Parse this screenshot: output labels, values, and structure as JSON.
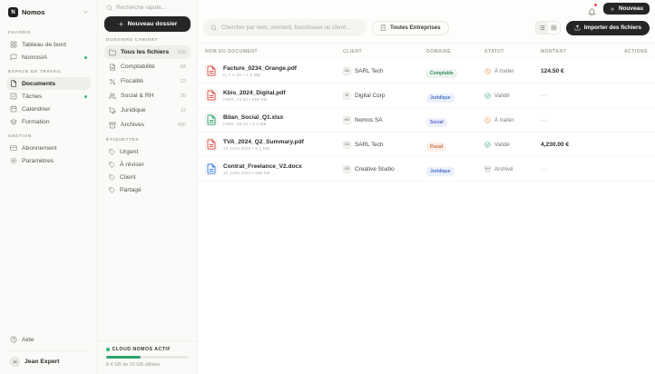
{
  "colors": {
    "accent_dark": "#262624",
    "green": "#2FA36B",
    "notification_red": "#E5484D",
    "status_pending": "#E8883C",
    "status_valid": "#3BA26B",
    "status_archived": "#9A9A94",
    "badge_green_text": "#3D8B5F",
    "badge_blue_text": "#4A73C9",
    "badge_indigo_text": "#5B68CE",
    "badge_orange_text": "#D4663B"
  },
  "sidebar": {
    "logo_letter": "N",
    "logo_name": "Nomos",
    "sections": [
      {
        "label": "Favoris",
        "items": [
          {
            "label": "Tableau de bord",
            "icon": "grid",
            "active": false,
            "dot": false
          },
          {
            "label": "NomosIA",
            "icon": "chat",
            "active": false,
            "dot": true
          }
        ]
      },
      {
        "label": "Espace de travail",
        "items": [
          {
            "label": "Documents",
            "icon": "file",
            "active": true,
            "dot": false
          },
          {
            "label": "Tâches",
            "icon": "check-square",
            "active": false,
            "dot": true
          },
          {
            "label": "Calendrier",
            "icon": "calendar",
            "active": false,
            "dot": false
          },
          {
            "label": "Formation",
            "icon": "cap",
            "active": false,
            "dot": false
          }
        ]
      },
      {
        "label": "Gestion",
        "items": [
          {
            "label": "Abonnement",
            "icon": "card",
            "active": false,
            "dot": false
          },
          {
            "label": "Paramètres",
            "icon": "gear",
            "active": false,
            "dot": false
          }
        ]
      }
    ],
    "help_label": "Aide",
    "user": {
      "initials": "JE",
      "name": "Jean Expert"
    }
  },
  "panel": {
    "search_placeholder": "Recherche rapide...",
    "new_folder_label": "Nouveau dossier",
    "folders_title": "Dossiers cabinet",
    "folders": [
      {
        "label": "Tous les fichiers",
        "count": "156",
        "icon": "folder",
        "active": true
      },
      {
        "label": "Comptabilité",
        "count": "84",
        "icon": "file-text",
        "active": false
      },
      {
        "label": "Fiscalité",
        "count": "22",
        "icon": "percent",
        "active": false
      },
      {
        "label": "Social & RH",
        "count": "35",
        "icon": "users",
        "active": false
      },
      {
        "label": "Juridique",
        "count": "12",
        "icon": "pen",
        "active": false
      },
      {
        "label": "Archives",
        "count": "450",
        "icon": "archive",
        "active": false
      }
    ],
    "tags_title": "Étiquettes",
    "tags": [
      {
        "label": "Urgent"
      },
      {
        "label": "À réviser"
      },
      {
        "label": "Client"
      },
      {
        "label": "Partagé"
      }
    ],
    "cloud": {
      "title": "Cloud Nomos actif",
      "usage": "8.4 GB de 20 GB utilisés",
      "percent_used": 42
    }
  },
  "topbar": {
    "new_label": "Nouveau",
    "search_placeholder": "Chercher par nom, montant, fournisseur ou client...",
    "filter_label": "Toutes Entreprises",
    "import_label": "Importer des fichiers"
  },
  "table": {
    "headers": [
      "Nom du document",
      "Client",
      "Domaine",
      "Statut",
      "Montant",
      "Actions"
    ],
    "rows": [
      {
        "name": "Facture_0234_Orange.pdf",
        "meta": "Il y a 2h • 1.2 MB",
        "filetype": "pdf",
        "client_initials": "SA",
        "client_name": "SARL Tech",
        "domain": "Comptable",
        "domain_color": "green",
        "status": "À traiter",
        "status_kind": "pending",
        "amount": "124.50 €"
      },
      {
        "name": "Kbis_2024_Digital.pdf",
        "meta": "Hier, 14:20 • 450 KB",
        "filetype": "pdf",
        "client_initials": "DI",
        "client_name": "Digital Corp",
        "domain": "Juridique",
        "domain_color": "blue",
        "status": "Validé",
        "status_kind": "valid",
        "amount": "---"
      },
      {
        "name": "Bilan_Social_Q1.xlsx",
        "meta": "Hier, 09:15 • 3.4 MB",
        "filetype": "xlsx",
        "client_initials": "NO",
        "client_name": "Nomos SA",
        "domain": "Social",
        "domain_color": "indigo",
        "status": "À traiter",
        "status_kind": "pending",
        "amount": "---"
      },
      {
        "name": "TVA_2024_Q2_Summary.pdf",
        "meta": "12 juin 2024 • 2.1 MB",
        "filetype": "pdf",
        "client_initials": "SA",
        "client_name": "SARL Tech",
        "domain": "Fiscal",
        "domain_color": "orange",
        "status": "Validé",
        "status_kind": "valid",
        "amount": "4,230.00 €"
      },
      {
        "name": "Contrat_Freelance_V2.docx",
        "meta": "10 juin 2024 • 890 KB",
        "filetype": "docx",
        "client_initials": "CR",
        "client_name": "Creative Studio",
        "domain": "Juridique",
        "domain_color": "blue",
        "status": "Archivé",
        "status_kind": "archived",
        "amount": "---"
      }
    ]
  }
}
